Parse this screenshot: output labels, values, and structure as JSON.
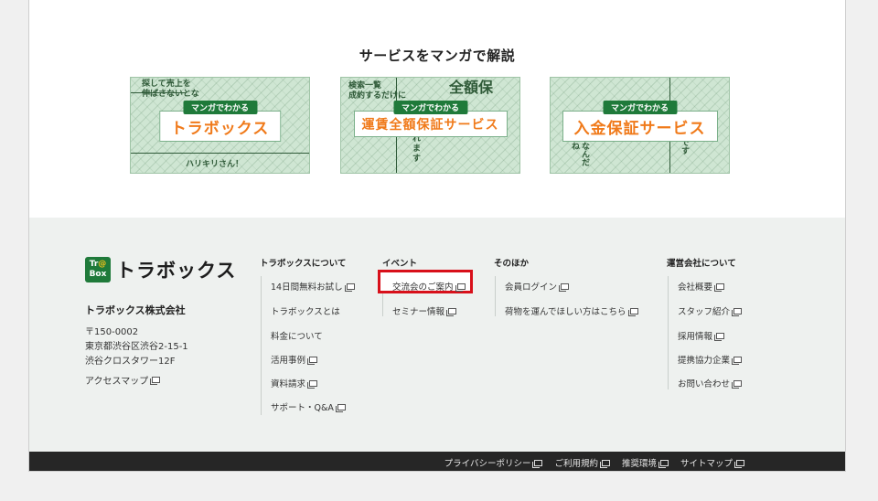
{
  "manga": {
    "title": "サービスをマンガで解説",
    "banners": [
      {
        "tag": "マンガでわかる",
        "name": "トラボックス",
        "deco_top": "探して売上を\n伸ばさないとな",
        "deco_bottom": "ハリキリさん！"
      },
      {
        "tag": "マンガでわかる",
        "name": "運賃全額保証サービス",
        "deco_top": "全額保",
        "deco_left": "検索一覧\n成約するだけに",
        "deco_bottom": "れ\nま\nす"
      },
      {
        "tag": "マンガでわかる",
        "name": "入金保証サービス",
        "deco_left": "なんだね",
        "deco_right": "です"
      }
    ]
  },
  "footer": {
    "logo": {
      "badge_top": "Tr",
      "badge_at": "@",
      "badge_bottom": "Box",
      "text": "トラボックス"
    },
    "company": "トラボックス株式会社",
    "address": [
      "〒150-0002",
      "東京都渋谷区渋谷2-15-1",
      "渋谷クロスタワー12F"
    ],
    "access_map": "アクセスマップ",
    "columns": {
      "about": {
        "title": "トラボックスについて",
        "links": [
          "14日間無料お試し",
          "トラボックスとは",
          "料金について",
          "活用事例",
          "資料請求",
          "サポート・Q&A"
        ]
      },
      "event": {
        "title": "イベント",
        "links": [
          "交流会のご案内",
          "セミナー情報"
        ]
      },
      "other": {
        "title": "そのほか",
        "links": [
          "会員ログイン",
          "荷物を運んでほしい方はこちら"
        ]
      },
      "company": {
        "title": "運営会社について",
        "links": [
          "会社概要",
          "スタッフ紹介",
          "採用情報",
          "提携協力企業",
          "お問い合わせ"
        ]
      }
    },
    "bottom_links": [
      "プライバシーポリシー",
      "ご利用規約",
      "推奨環境",
      "サイトマップ"
    ]
  },
  "colors": {
    "accent_green": "#1f7a3a",
    "banner_orange": "#f07a1a",
    "highlight_red": "#d8101a",
    "footer_bg": "#eef1ef",
    "bottombar_bg": "#262626"
  }
}
